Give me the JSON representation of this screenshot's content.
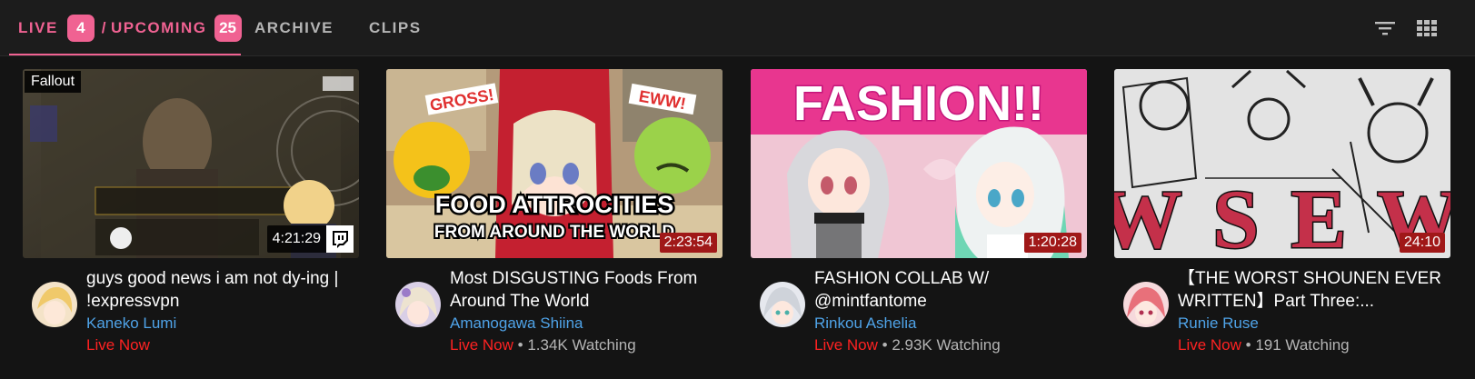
{
  "tabs": {
    "live_label": "LIVE",
    "live_count": "4",
    "separator": "/",
    "upcoming_label": "UPCOMING",
    "upcoming_count": "25",
    "archive_label": "ARCHIVE",
    "clips_label": "CLIPS"
  },
  "toolbar": {
    "filter_icon": "filter-icon",
    "grid_icon": "grid-view-icon"
  },
  "videos": [
    {
      "topic": "Fallout",
      "duration": "4:21:29",
      "title": "guys good news i am not dy-ing | !expressvpn",
      "channel": "Kaneko Lumi",
      "live_label": "Live Now",
      "watching": "",
      "platform_icon": "twitch-icon"
    },
    {
      "duration": "2:23:54",
      "title": "Most DISGUSTING Foods From Around The World",
      "channel": "Amanogawa Shiina",
      "live_label": "Live Now",
      "watching": " • 1.34K Watching",
      "thumb_text": {
        "gross": "GROSS!",
        "eww": "EWW!",
        "line1": "FOOD ATTROCITIES",
        "line2": "FROM AROUND THE WORLD"
      }
    },
    {
      "duration": "1:20:28",
      "title": "FASHION COLLAB W/ @mintfantome",
      "channel": "Rinkou Ashelia",
      "live_label": "Live Now",
      "watching": " • 2.93K Watching",
      "thumb_text": {
        "headline": "FASHION!!"
      }
    },
    {
      "duration": "24:10",
      "title": "【THE WORST SHOUNEN EVER WRITTEN】Part Three:...",
      "channel": "Runie Ruse",
      "live_label": "Live Now",
      "watching": " • 191 Watching",
      "thumb_text": {
        "letters": "W S E W"
      }
    }
  ],
  "colors": {
    "accent": "#f06292",
    "live": "#ff2222",
    "channel": "#4fa3e8",
    "background": "#141414"
  }
}
